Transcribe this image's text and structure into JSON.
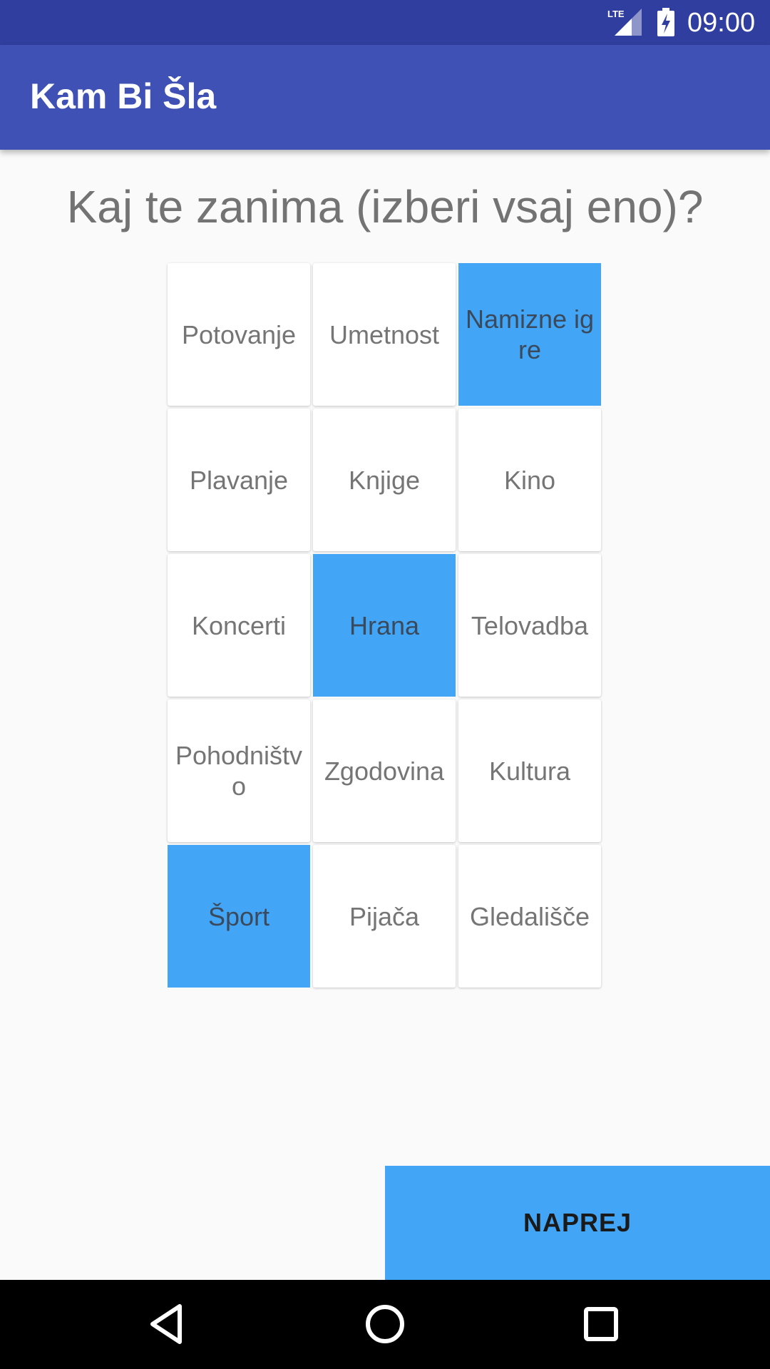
{
  "status_bar": {
    "network_icon": "lte-signal-icon",
    "battery_icon": "battery-charging-icon",
    "network_label": "LTE",
    "time": "09:00"
  },
  "app_bar": {
    "title": "Kam Bi Šla"
  },
  "question": "Kaj te zanima (izberi vsaj eno)?",
  "interests": [
    {
      "label": "Potovanje",
      "selected": false
    },
    {
      "label": "Umetnost",
      "selected": false
    },
    {
      "label": "Namizne igre",
      "selected": true
    },
    {
      "label": "Plavanje",
      "selected": false
    },
    {
      "label": "Knjige",
      "selected": false
    },
    {
      "label": "Kino",
      "selected": false
    },
    {
      "label": "Koncerti",
      "selected": false
    },
    {
      "label": "Hrana",
      "selected": true
    },
    {
      "label": "Telovadba",
      "selected": false
    },
    {
      "label": "Pohodništvo",
      "selected": false
    },
    {
      "label": "Zgodovina",
      "selected": false
    },
    {
      "label": "Kultura",
      "selected": false
    },
    {
      "label": "Šport",
      "selected": true
    },
    {
      "label": "Pijača",
      "selected": false
    },
    {
      "label": "Gledališče",
      "selected": false
    }
  ],
  "next_button": {
    "label": "NAPREJ"
  },
  "colors": {
    "primary": "#3f51b5",
    "primary_dark": "#303f9f",
    "accent": "#42a5f5",
    "tile_bg": "#ffffff",
    "page_bg": "#fafafa"
  },
  "nav_bar": {
    "icons": [
      "back-icon",
      "home-icon",
      "recents-icon"
    ]
  }
}
